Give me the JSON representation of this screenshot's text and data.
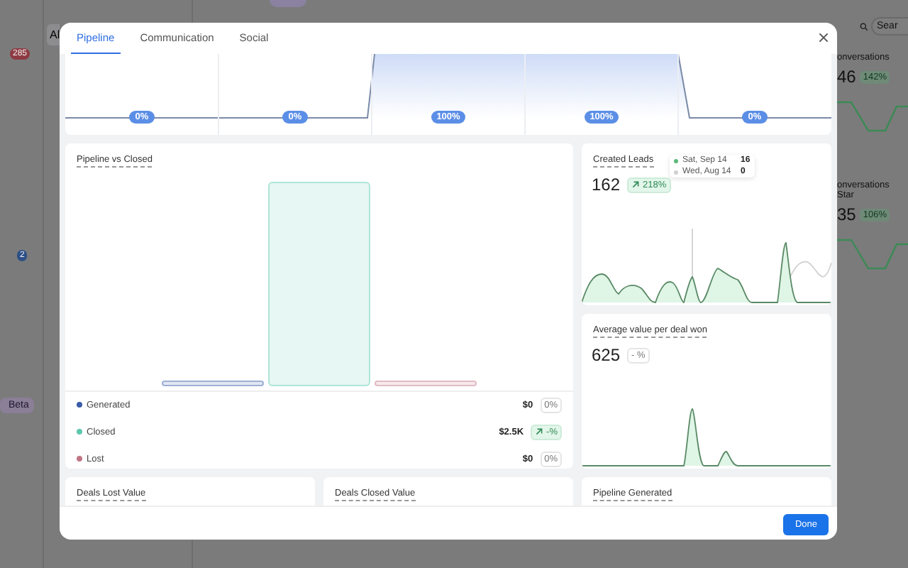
{
  "background": {
    "list_header": "Al",
    "badges": [
      {
        "text": "285",
        "color": "#8e3a42"
      },
      {
        "text": "2",
        "color": "#2d4f86"
      }
    ],
    "beta_label": "Beta",
    "search": {
      "placeholder": "Sear"
    },
    "metrics": [
      {
        "title": "onversations",
        "value": "46",
        "change": "142%"
      },
      {
        "title": "onversations Star",
        "value": "35",
        "change": "106%"
      }
    ]
  },
  "modal": {
    "tabs": [
      {
        "label": "Pipeline",
        "selected": true
      },
      {
        "label": "Communication",
        "selected": false
      },
      {
        "label": "Social",
        "selected": false
      }
    ],
    "funnel": {
      "stages": [
        {
          "label": "0%"
        },
        {
          "label": "0%"
        },
        {
          "label": "100%"
        },
        {
          "label": "100%"
        },
        {
          "label": "0%"
        }
      ]
    },
    "pipeline_vs_closed": {
      "title": "Pipeline vs Closed",
      "legend": [
        {
          "name": "Generated",
          "color": "#3a5ca8",
          "amount": "$0",
          "change": "0%",
          "rising": false
        },
        {
          "name": "Closed",
          "color": "#5cc7ad",
          "amount": "$2.5K",
          "change": "-%",
          "rising": true
        },
        {
          "name": "Lost",
          "color": "#c07584",
          "amount": "$0",
          "change": "0%",
          "rising": false
        }
      ]
    },
    "created_leads": {
      "title": "Created Leads",
      "value": "162",
      "change": "218%",
      "rising": true,
      "tooltip": [
        {
          "date": "Sat, Sep 14",
          "value": "16",
          "color": "#5cb87a"
        },
        {
          "date": "Wed, Aug 14",
          "value": "0",
          "color": "#d0d0d0"
        }
      ]
    },
    "average_value": {
      "title": "Average value per deal won",
      "value": "625",
      "change": "- %",
      "rising": false
    },
    "bottom_cards": [
      {
        "title": "Deals Lost Value"
      },
      {
        "title": "Deals Closed Value"
      },
      {
        "title": "Pipeline Generated"
      }
    ],
    "done_button": "Done"
  }
}
